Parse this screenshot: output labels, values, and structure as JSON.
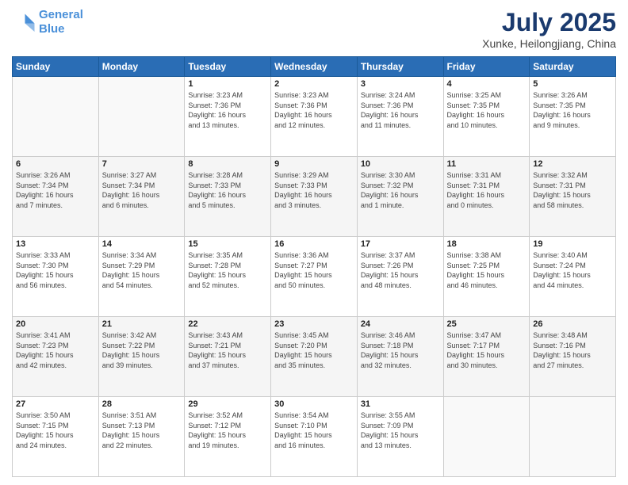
{
  "header": {
    "logo_line1": "General",
    "logo_line2": "Blue",
    "main_title": "July 2025",
    "subtitle": "Xunke, Heilongjiang, China"
  },
  "weekdays": [
    "Sunday",
    "Monday",
    "Tuesday",
    "Wednesday",
    "Thursday",
    "Friday",
    "Saturday"
  ],
  "weeks": [
    [
      {
        "day": "",
        "info": ""
      },
      {
        "day": "",
        "info": ""
      },
      {
        "day": "1",
        "info": "Sunrise: 3:23 AM\nSunset: 7:36 PM\nDaylight: 16 hours\nand 13 minutes."
      },
      {
        "day": "2",
        "info": "Sunrise: 3:23 AM\nSunset: 7:36 PM\nDaylight: 16 hours\nand 12 minutes."
      },
      {
        "day": "3",
        "info": "Sunrise: 3:24 AM\nSunset: 7:36 PM\nDaylight: 16 hours\nand 11 minutes."
      },
      {
        "day": "4",
        "info": "Sunrise: 3:25 AM\nSunset: 7:35 PM\nDaylight: 16 hours\nand 10 minutes."
      },
      {
        "day": "5",
        "info": "Sunrise: 3:26 AM\nSunset: 7:35 PM\nDaylight: 16 hours\nand 9 minutes."
      }
    ],
    [
      {
        "day": "6",
        "info": "Sunrise: 3:26 AM\nSunset: 7:34 PM\nDaylight: 16 hours\nand 7 minutes."
      },
      {
        "day": "7",
        "info": "Sunrise: 3:27 AM\nSunset: 7:34 PM\nDaylight: 16 hours\nand 6 minutes."
      },
      {
        "day": "8",
        "info": "Sunrise: 3:28 AM\nSunset: 7:33 PM\nDaylight: 16 hours\nand 5 minutes."
      },
      {
        "day": "9",
        "info": "Sunrise: 3:29 AM\nSunset: 7:33 PM\nDaylight: 16 hours\nand 3 minutes."
      },
      {
        "day": "10",
        "info": "Sunrise: 3:30 AM\nSunset: 7:32 PM\nDaylight: 16 hours\nand 1 minute."
      },
      {
        "day": "11",
        "info": "Sunrise: 3:31 AM\nSunset: 7:31 PM\nDaylight: 16 hours\nand 0 minutes."
      },
      {
        "day": "12",
        "info": "Sunrise: 3:32 AM\nSunset: 7:31 PM\nDaylight: 15 hours\nand 58 minutes."
      }
    ],
    [
      {
        "day": "13",
        "info": "Sunrise: 3:33 AM\nSunset: 7:30 PM\nDaylight: 15 hours\nand 56 minutes."
      },
      {
        "day": "14",
        "info": "Sunrise: 3:34 AM\nSunset: 7:29 PM\nDaylight: 15 hours\nand 54 minutes."
      },
      {
        "day": "15",
        "info": "Sunrise: 3:35 AM\nSunset: 7:28 PM\nDaylight: 15 hours\nand 52 minutes."
      },
      {
        "day": "16",
        "info": "Sunrise: 3:36 AM\nSunset: 7:27 PM\nDaylight: 15 hours\nand 50 minutes."
      },
      {
        "day": "17",
        "info": "Sunrise: 3:37 AM\nSunset: 7:26 PM\nDaylight: 15 hours\nand 48 minutes."
      },
      {
        "day": "18",
        "info": "Sunrise: 3:38 AM\nSunset: 7:25 PM\nDaylight: 15 hours\nand 46 minutes."
      },
      {
        "day": "19",
        "info": "Sunrise: 3:40 AM\nSunset: 7:24 PM\nDaylight: 15 hours\nand 44 minutes."
      }
    ],
    [
      {
        "day": "20",
        "info": "Sunrise: 3:41 AM\nSunset: 7:23 PM\nDaylight: 15 hours\nand 42 minutes."
      },
      {
        "day": "21",
        "info": "Sunrise: 3:42 AM\nSunset: 7:22 PM\nDaylight: 15 hours\nand 39 minutes."
      },
      {
        "day": "22",
        "info": "Sunrise: 3:43 AM\nSunset: 7:21 PM\nDaylight: 15 hours\nand 37 minutes."
      },
      {
        "day": "23",
        "info": "Sunrise: 3:45 AM\nSunset: 7:20 PM\nDaylight: 15 hours\nand 35 minutes."
      },
      {
        "day": "24",
        "info": "Sunrise: 3:46 AM\nSunset: 7:18 PM\nDaylight: 15 hours\nand 32 minutes."
      },
      {
        "day": "25",
        "info": "Sunrise: 3:47 AM\nSunset: 7:17 PM\nDaylight: 15 hours\nand 30 minutes."
      },
      {
        "day": "26",
        "info": "Sunrise: 3:48 AM\nSunset: 7:16 PM\nDaylight: 15 hours\nand 27 minutes."
      }
    ],
    [
      {
        "day": "27",
        "info": "Sunrise: 3:50 AM\nSunset: 7:15 PM\nDaylight: 15 hours\nand 24 minutes."
      },
      {
        "day": "28",
        "info": "Sunrise: 3:51 AM\nSunset: 7:13 PM\nDaylight: 15 hours\nand 22 minutes."
      },
      {
        "day": "29",
        "info": "Sunrise: 3:52 AM\nSunset: 7:12 PM\nDaylight: 15 hours\nand 19 minutes."
      },
      {
        "day": "30",
        "info": "Sunrise: 3:54 AM\nSunset: 7:10 PM\nDaylight: 15 hours\nand 16 minutes."
      },
      {
        "day": "31",
        "info": "Sunrise: 3:55 AM\nSunset: 7:09 PM\nDaylight: 15 hours\nand 13 minutes."
      },
      {
        "day": "",
        "info": ""
      },
      {
        "day": "",
        "info": ""
      }
    ]
  ]
}
